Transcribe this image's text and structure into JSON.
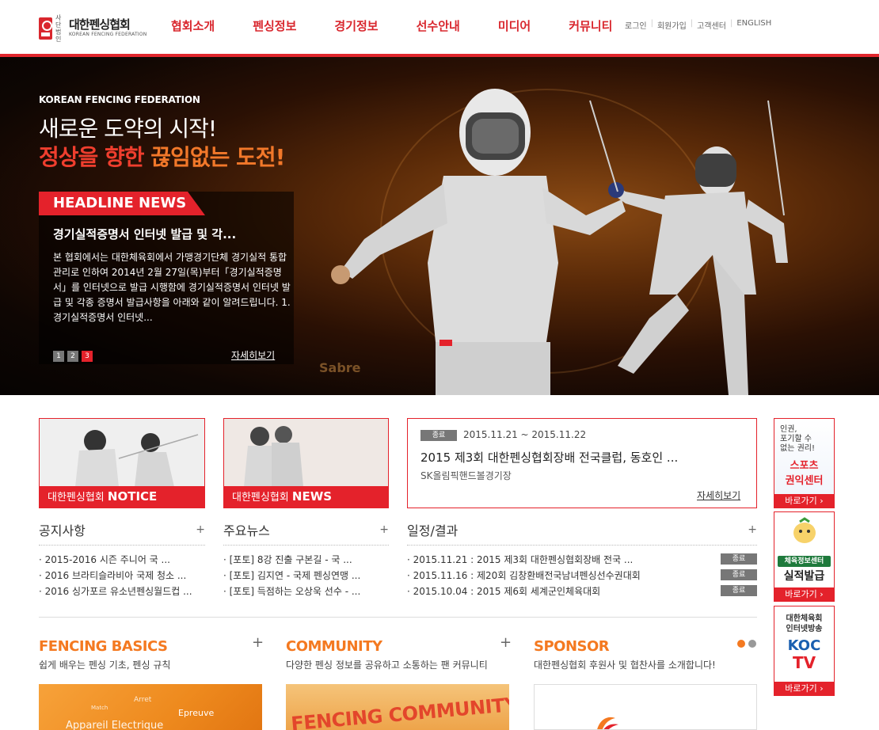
{
  "header": {
    "logo_small": "사단 법인",
    "logo_name": "대한펜싱협회",
    "logo_en": "KOREAN FENCING FEDERATION",
    "gnb": [
      "협회소개",
      "펜싱정보",
      "경기정보",
      "선수안내",
      "미디어",
      "커뮤니티"
    ],
    "util": [
      "로그인",
      "회원가입",
      "고객센터",
      "ENGLISH"
    ]
  },
  "hero": {
    "subtitle": "KOREAN FENCING FEDERATION",
    "line1": "새로운 도약의 시작!",
    "line2_a": "정상을 향한 ",
    "line2_b": "끊임없는 도전!",
    "sabre_text": "Sabre",
    "headline": {
      "tag": "HEADLINE NEWS",
      "title": "경기실적증명서 인터넷 발급 및 각...",
      "body": " 본 협회에서는 대한체육회에서 가맹경기단체 경기실적 통합관리로 인하여 2014년 2월 27일(목)부터「경기실적증명서」를 인터넷으로 발급 시행함에 경기실적증명서 인터넷 발급 및 각종 증명서 발급사항을 아래와 같이 알려드립니다.       1. 경기실적증명서 인터넷...",
      "pages": [
        "1",
        "2",
        "3"
      ],
      "more": "자세히보기"
    }
  },
  "notice_banner": {
    "prefix": "대한펜싱협회 ",
    "label": "NOTICE"
  },
  "news_banner": {
    "prefix": "대한펜싱협회 ",
    "label": "NEWS"
  },
  "schedule_card": {
    "status": "종료",
    "date": "2015.11.21 ~ 2015.11.22",
    "title": "2015 제3회 대한펜싱협회장배 전국클럽, 동호인 ...",
    "place": "SK올림픽핸드볼경기장",
    "more": "자세히보기"
  },
  "notices": {
    "title": "공지사항",
    "plus": "+",
    "items": [
      "· 2015-2016 시즌 주니어 국 ...",
      "· 2016 브라티슬라비아 국제 청소 ...",
      "· 2016 싱가포르 유소년펜싱월드컵 ..."
    ]
  },
  "news": {
    "title": "주요뉴스",
    "plus": "+",
    "items": [
      "· [포토] 8강 진출 구본길 - 국 ...",
      "· [포토] 김지연 - 국제 펜싱연맹 ...",
      "· [포토] 득점하는 오상욱 선수 - ..."
    ]
  },
  "schedule": {
    "title": "일정/결과",
    "plus": "+",
    "items": [
      {
        "text": "· 2015.11.21 : 2015 제3회 대한펜싱협회장배 전국 ...",
        "status": "종료"
      },
      {
        "text": "· 2015.11.16 : 제20회 김창환배전국남녀펜싱선수권대회",
        "status": "종료"
      },
      {
        "text": "· 2015.10.04 : 2015 제6회 세계군인체육대회",
        "status": "종료"
      }
    ]
  },
  "bottom": {
    "basics": {
      "title": "FENCING BASICS",
      "sub": "쉽게 배우는 펜싱 기초, 펜싱 규칙",
      "plus": "+",
      "words": [
        "Arret",
        "Match",
        "Epreuve",
        "Appareil Electrique"
      ]
    },
    "community": {
      "title": "COMMUNITY",
      "sub": "다양한 펜싱 정보를 공유하고 소통하는 팬 커뮤니티",
      "plus": "+",
      "img_text": "FENCING COMMUNITY"
    },
    "sponsor": {
      "title": "SPONSOR",
      "sub": "대한펜싱협회 후원사 및 협찬사를 소개합니다!"
    }
  },
  "side": {
    "rights": {
      "text1": "인권,",
      "text2": "포기할 수",
      "text3": "없는 권리!",
      "name1": "스포츠",
      "name2": "권익센터",
      "go": "바로가기 ›"
    },
    "info": {
      "badge": "체육정보센터",
      "name": "실적발급",
      "go": "바로가기 ›"
    },
    "koc": {
      "text1": "대한체육회",
      "text2": "인터넷방송",
      "logo1": "KOC",
      "logo2": "TV",
      "go": "바로가기 ›"
    }
  },
  "colors": {
    "brand_red": "#e4222b",
    "accent_orange": "#f47920"
  }
}
